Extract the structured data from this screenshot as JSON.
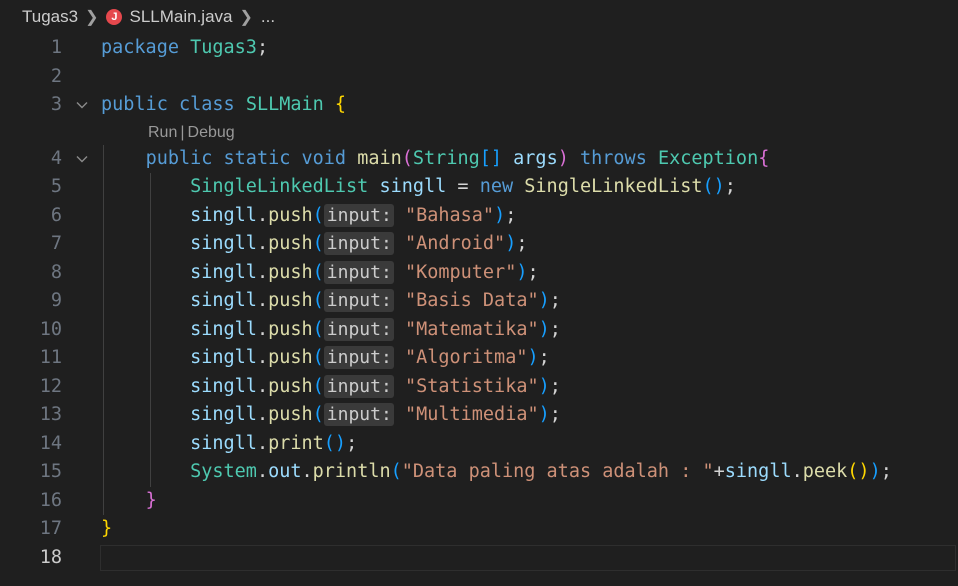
{
  "breadcrumb": {
    "folder": "Tugas3",
    "file": "SLLMain.java",
    "file_icon_letter": "J",
    "more": "..."
  },
  "codelens": {
    "run": "Run",
    "separator": "|",
    "debug": "Debug"
  },
  "colors": {
    "background": "#1f1f1f",
    "keyword": "#569cd6",
    "type": "#4ec9b0",
    "variable": "#9cdcfe",
    "function": "#dcdcaa",
    "string": "#ce9178",
    "bracket_1": "#ffd700",
    "bracket_2": "#da70d6",
    "bracket_3": "#179fff",
    "java_icon": "#e5484d"
  },
  "editor": {
    "current_line": 18,
    "lines": [
      {
        "n": "1",
        "tokens": [
          [
            "kw",
            "package"
          ],
          [
            "plain",
            " "
          ],
          [
            "ty",
            "Tugas3"
          ],
          [
            "plain",
            ";"
          ]
        ]
      },
      {
        "n": "2",
        "tokens": []
      },
      {
        "n": "3",
        "fold": true,
        "tokens": [
          [
            "kw",
            "public"
          ],
          [
            "plain",
            " "
          ],
          [
            "kw",
            "class"
          ],
          [
            "plain",
            " "
          ],
          [
            "ty",
            "SLLMain"
          ],
          [
            "plain",
            " "
          ],
          [
            "b1",
            "{"
          ]
        ]
      },
      {
        "n": "4",
        "fold": true,
        "codelens_above": true,
        "tokens": [
          [
            "plain",
            "    "
          ],
          [
            "kw",
            "public"
          ],
          [
            "plain",
            " "
          ],
          [
            "kw",
            "static"
          ],
          [
            "plain",
            " "
          ],
          [
            "kw",
            "void"
          ],
          [
            "plain",
            " "
          ],
          [
            "fn",
            "main"
          ],
          [
            "b2",
            "("
          ],
          [
            "ty",
            "String"
          ],
          [
            "b3",
            "[]"
          ],
          [
            "plain",
            " "
          ],
          [
            "var",
            "args"
          ],
          [
            "b2",
            ")"
          ],
          [
            "plain",
            " "
          ],
          [
            "kw",
            "throws"
          ],
          [
            "plain",
            " "
          ],
          [
            "ty",
            "Exception"
          ],
          [
            "b2",
            "{"
          ]
        ]
      },
      {
        "n": "5",
        "tokens": [
          [
            "plain",
            "        "
          ],
          [
            "ty",
            "SingleLinkedList"
          ],
          [
            "plain",
            " "
          ],
          [
            "var",
            "singll"
          ],
          [
            "plain",
            " = "
          ],
          [
            "kw",
            "new"
          ],
          [
            "plain",
            " "
          ],
          [
            "fn",
            "SingleLinkedList"
          ],
          [
            "b3",
            "()"
          ],
          [
            "plain",
            ";"
          ]
        ]
      },
      {
        "n": "6",
        "tokens": [
          [
            "plain",
            "        "
          ],
          [
            "var",
            "singll"
          ],
          [
            "plain",
            "."
          ],
          [
            "fn",
            "push"
          ],
          [
            "b3",
            "("
          ],
          [
            "hint",
            "input:"
          ],
          [
            "plain",
            " "
          ],
          [
            "str",
            "\"Bahasa\""
          ],
          [
            "b3",
            ")"
          ],
          [
            "plain",
            ";"
          ]
        ]
      },
      {
        "n": "7",
        "tokens": [
          [
            "plain",
            "        "
          ],
          [
            "var",
            "singll"
          ],
          [
            "plain",
            "."
          ],
          [
            "fn",
            "push"
          ],
          [
            "b3",
            "("
          ],
          [
            "hint",
            "input:"
          ],
          [
            "plain",
            " "
          ],
          [
            "str",
            "\"Android\""
          ],
          [
            "b3",
            ")"
          ],
          [
            "plain",
            ";"
          ]
        ]
      },
      {
        "n": "8",
        "tokens": [
          [
            "plain",
            "        "
          ],
          [
            "var",
            "singll"
          ],
          [
            "plain",
            "."
          ],
          [
            "fn",
            "push"
          ],
          [
            "b3",
            "("
          ],
          [
            "hint",
            "input:"
          ],
          [
            "plain",
            " "
          ],
          [
            "str",
            "\"Komputer\""
          ],
          [
            "b3",
            ")"
          ],
          [
            "plain",
            ";"
          ]
        ]
      },
      {
        "n": "9",
        "tokens": [
          [
            "plain",
            "        "
          ],
          [
            "var",
            "singll"
          ],
          [
            "plain",
            "."
          ],
          [
            "fn",
            "push"
          ],
          [
            "b3",
            "("
          ],
          [
            "hint",
            "input:"
          ],
          [
            "plain",
            " "
          ],
          [
            "str",
            "\"Basis Data\""
          ],
          [
            "b3",
            ")"
          ],
          [
            "plain",
            ";"
          ]
        ]
      },
      {
        "n": "10",
        "tokens": [
          [
            "plain",
            "        "
          ],
          [
            "var",
            "singll"
          ],
          [
            "plain",
            "."
          ],
          [
            "fn",
            "push"
          ],
          [
            "b3",
            "("
          ],
          [
            "hint",
            "input:"
          ],
          [
            "plain",
            " "
          ],
          [
            "str",
            "\"Matematika\""
          ],
          [
            "b3",
            ")"
          ],
          [
            "plain",
            ";"
          ]
        ]
      },
      {
        "n": "11",
        "tokens": [
          [
            "plain",
            "        "
          ],
          [
            "var",
            "singll"
          ],
          [
            "plain",
            "."
          ],
          [
            "fn",
            "push"
          ],
          [
            "b3",
            "("
          ],
          [
            "hint",
            "input:"
          ],
          [
            "plain",
            " "
          ],
          [
            "str",
            "\"Algoritma\""
          ],
          [
            "b3",
            ")"
          ],
          [
            "plain",
            ";"
          ]
        ]
      },
      {
        "n": "12",
        "tokens": [
          [
            "plain",
            "        "
          ],
          [
            "var",
            "singll"
          ],
          [
            "plain",
            "."
          ],
          [
            "fn",
            "push"
          ],
          [
            "b3",
            "("
          ],
          [
            "hint",
            "input:"
          ],
          [
            "plain",
            " "
          ],
          [
            "str",
            "\"Statistika\""
          ],
          [
            "b3",
            ")"
          ],
          [
            "plain",
            ";"
          ]
        ]
      },
      {
        "n": "13",
        "tokens": [
          [
            "plain",
            "        "
          ],
          [
            "var",
            "singll"
          ],
          [
            "plain",
            "."
          ],
          [
            "fn",
            "push"
          ],
          [
            "b3",
            "("
          ],
          [
            "hint",
            "input:"
          ],
          [
            "plain",
            " "
          ],
          [
            "str",
            "\"Multimedia\""
          ],
          [
            "b3",
            ")"
          ],
          [
            "plain",
            ";"
          ]
        ]
      },
      {
        "n": "14",
        "tokens": [
          [
            "plain",
            "        "
          ],
          [
            "var",
            "singll"
          ],
          [
            "plain",
            "."
          ],
          [
            "fn",
            "print"
          ],
          [
            "b3",
            "()"
          ],
          [
            "plain",
            ";"
          ]
        ]
      },
      {
        "n": "15",
        "tokens": [
          [
            "plain",
            "        "
          ],
          [
            "ty",
            "System"
          ],
          [
            "plain",
            "."
          ],
          [
            "var",
            "out"
          ],
          [
            "plain",
            "."
          ],
          [
            "fn",
            "println"
          ],
          [
            "b3",
            "("
          ],
          [
            "str",
            "\"Data paling atas adalah : \""
          ],
          [
            "plain",
            "+"
          ],
          [
            "var",
            "singll"
          ],
          [
            "plain",
            "."
          ],
          [
            "fn",
            "peek"
          ],
          [
            "b1",
            "()"
          ],
          [
            "b3",
            ")"
          ],
          [
            "plain",
            ";"
          ]
        ]
      },
      {
        "n": "16",
        "tokens": [
          [
            "plain",
            "    "
          ],
          [
            "b2",
            "}"
          ]
        ]
      },
      {
        "n": "17",
        "tokens": [
          [
            "b1",
            "}"
          ]
        ]
      },
      {
        "n": "18",
        "tokens": []
      }
    ]
  }
}
